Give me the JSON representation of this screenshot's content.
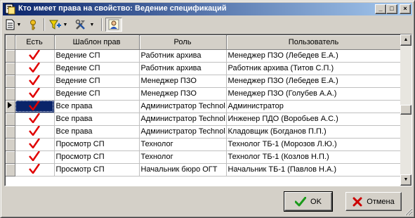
{
  "window": {
    "title": "Кто имеет права на свойство: Ведение спецификаций",
    "minimize": "_",
    "maximize": "□",
    "close": "×"
  },
  "toolbar": {
    "icons": [
      "document-icon",
      "key-icon",
      "filter-icon",
      "tools-icon",
      "user-icon"
    ]
  },
  "table": {
    "columns": [
      "Есть",
      "Шаблон прав",
      "Роль",
      "Пользователь"
    ],
    "rows": [
      {
        "has": true,
        "template": "Ведение СП",
        "role": "Работник архива",
        "user": "Менеджер ПЗО (Лебедев Е.А.)"
      },
      {
        "has": true,
        "template": "Ведение СП",
        "role": "Работник архива",
        "user": "Работник архива (Титов С.П.)"
      },
      {
        "has": true,
        "template": "Ведение СП",
        "role": "Менеджер ПЗО",
        "user": "Менеджер ПЗО (Лебедев Е.А.)"
      },
      {
        "has": true,
        "template": "Ведение СП",
        "role": "Менеджер ПЗО",
        "user": "Менеджер ПЗО (Голубев А.А.)"
      },
      {
        "has": true,
        "template": "Все права",
        "role": "Администратор Technol",
        "user": "Администратор",
        "selected": true
      },
      {
        "has": true,
        "template": "Все права",
        "role": "Администратор Technol",
        "user": "Инженер ПДО (Воробьев А.С.)"
      },
      {
        "has": true,
        "template": "Все права",
        "role": "Администратор Technol",
        "user": "Кладовщик (Богданов П.П.)"
      },
      {
        "has": true,
        "template": "Просмотр СП",
        "role": "Технолог",
        "user": "Технолог ТБ-1 (Морозов Л.Ю.)"
      },
      {
        "has": true,
        "template": "Просмотр СП",
        "role": "Технолог",
        "user": "Технолог ТБ-1 (Козлов Н.П.)"
      },
      {
        "has": true,
        "template": "Просмотр СП",
        "role": "Начальник бюро ОГТ",
        "user": "Начальник ТБ-1 (Павлов Н.А.)"
      }
    ]
  },
  "buttons": {
    "ok": "OK",
    "cancel": "Отмена"
  },
  "colors": {
    "title_start": "#0a246a",
    "title_end": "#a6caf0",
    "check": "#e00000",
    "ok_icon": "#1a9a1a",
    "cancel_icon": "#cc0000"
  }
}
